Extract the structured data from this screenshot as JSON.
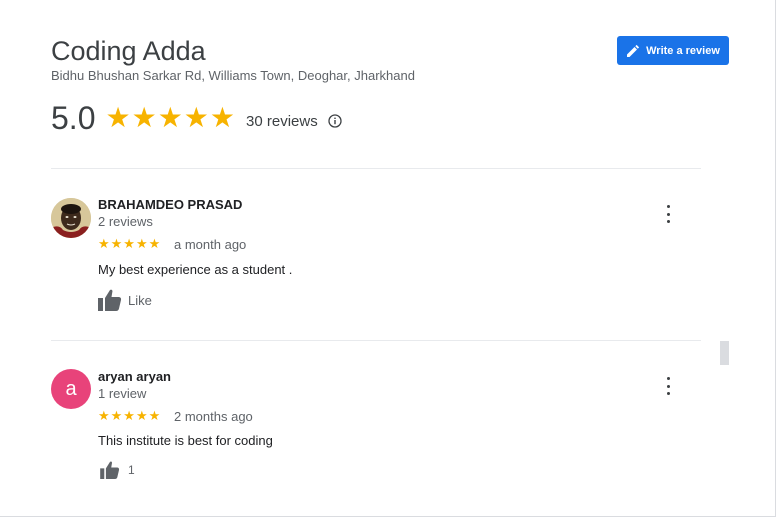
{
  "place": {
    "name": "Coding Adda",
    "address": "Bidhu Bhushan Sarkar Rd, Williams Town, Deoghar, Jharkhand",
    "rating": "5.0",
    "stars": "★★★★★",
    "review_count": "30 reviews"
  },
  "write_review": {
    "label": "Write a review",
    "icon": "pencil-icon"
  },
  "colors": {
    "accent": "#1a73e8",
    "star": "#f7b300",
    "avatar_a": "#e8437a"
  },
  "reviews": [
    {
      "name": "BRAHAMDEO PRASAD",
      "meta": "2 reviews",
      "stars": "★★★★★",
      "date": "a month ago",
      "text": "My best experience as a student .",
      "like_label": "Like",
      "avatar": "profile-photo"
    },
    {
      "name": "aryan aryan",
      "meta": "1 review",
      "stars": "★★★★★",
      "date": "2 months ago",
      "text": "This institute is best for coding",
      "like_label": "1",
      "avatar_letter": "a"
    }
  ]
}
